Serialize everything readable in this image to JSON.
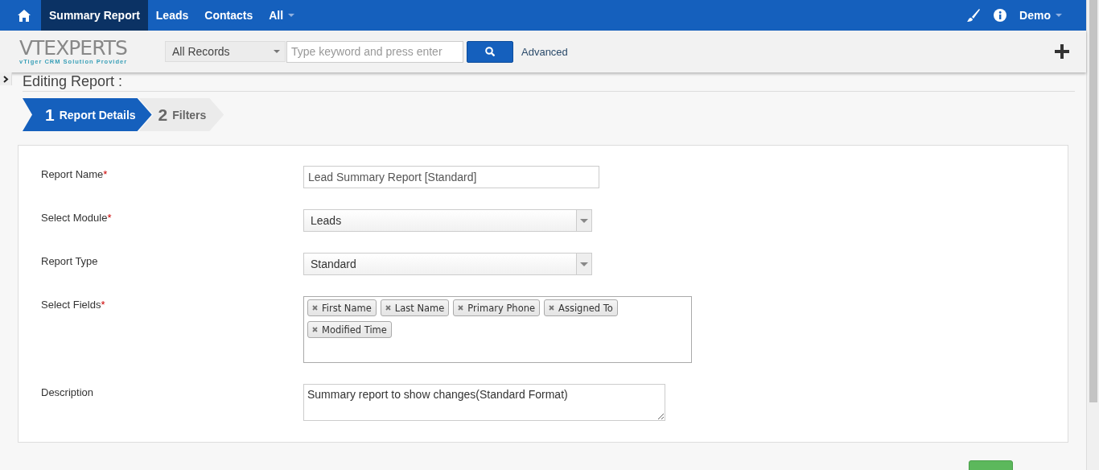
{
  "nav": {
    "tabs": [
      {
        "label": "Summary Report",
        "selected": true
      },
      {
        "label": "Leads",
        "selected": false
      },
      {
        "label": "Contacts",
        "selected": false
      },
      {
        "label": "All",
        "selected": false
      }
    ],
    "user": "Demo"
  },
  "search": {
    "logo": "VTEXPERTS",
    "logo_tagline": "vTiger CRM Solution Provider",
    "scope": "All Records",
    "placeholder": "Type keyword and press enter",
    "advanced": "Advanced"
  },
  "page_title": "Editing Report :",
  "steps": [
    {
      "number": "1",
      "label": "Report Details",
      "selected": true
    },
    {
      "number": "2",
      "label": "Filters",
      "selected": false
    }
  ],
  "fields": [
    {
      "kind": "text",
      "label": "Report Name",
      "required_mark": "*",
      "value": "Lead Summary Report [Standard]"
    },
    {
      "kind": "select",
      "label": "Select Module",
      "required_mark": "*",
      "value": "Leads"
    },
    {
      "kind": "select",
      "label": "Report Type",
      "value": "Standard"
    },
    {
      "kind": "tags",
      "label": "Select Fields",
      "required_mark": "*",
      "tags": [
        "First Name",
        "Last Name",
        "Primary Phone",
        "Assigned To",
        "Modified Time"
      ]
    },
    {
      "kind": "textarea",
      "label": "Description",
      "value": "Summary report to show changes(Standard Format)"
    }
  ]
}
